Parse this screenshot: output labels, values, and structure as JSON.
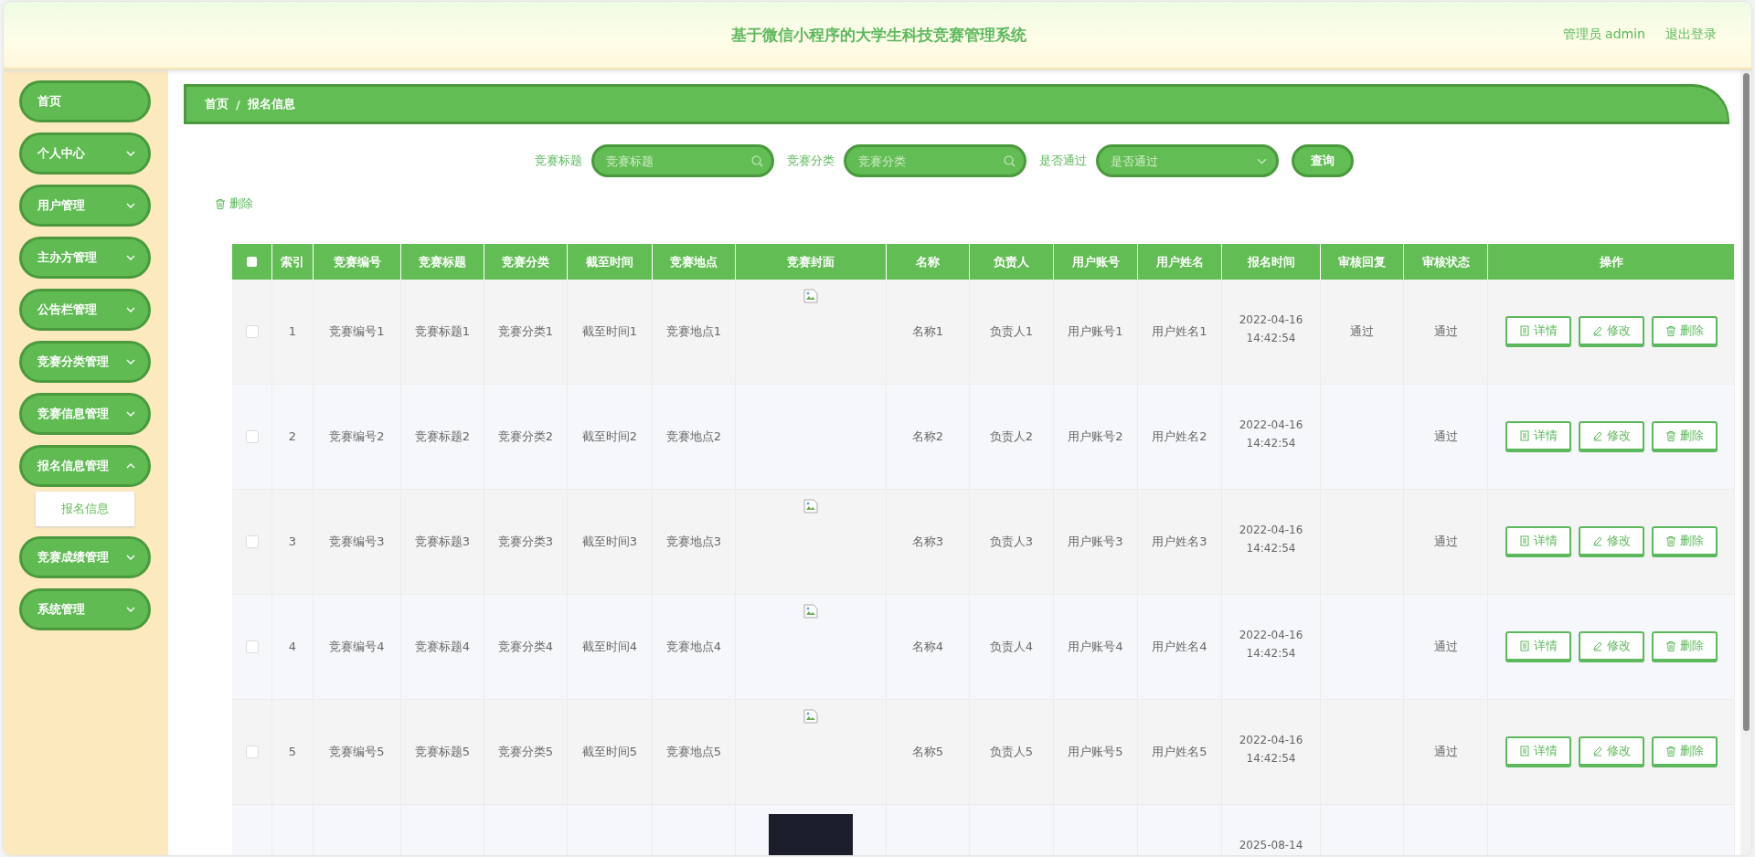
{
  "header": {
    "title": "基于微信小程序的大学生科技竞赛管理系统",
    "user": "管理员 admin",
    "logout": "退出登录"
  },
  "sidebar": {
    "items": [
      {
        "label": "首页"
      },
      {
        "label": "个人中心",
        "expanded": false
      },
      {
        "label": "用户管理",
        "expanded": false
      },
      {
        "label": "主办方管理",
        "expanded": false
      },
      {
        "label": "公告栏管理",
        "expanded": false
      },
      {
        "label": "竞赛分类管理",
        "expanded": false
      },
      {
        "label": "竞赛信息管理",
        "expanded": false
      },
      {
        "label": "报名信息管理",
        "expanded": true,
        "children": [
          {
            "label": "报名信息",
            "selected": true
          }
        ]
      },
      {
        "label": "竞赛成绩管理",
        "expanded": false
      },
      {
        "label": "系统管理",
        "expanded": false
      }
    ]
  },
  "breadcrumb": {
    "items": [
      "首页",
      "报名信息"
    ],
    "separator": "/"
  },
  "search": {
    "fields": [
      {
        "kind": "text",
        "label": "竞赛标题",
        "placeholder": "竞赛标题"
      },
      {
        "kind": "text",
        "label": "竞赛分类",
        "placeholder": "竞赛分类"
      },
      {
        "kind": "select",
        "label": "是否通过",
        "placeholder": "是否通过"
      }
    ],
    "button": "查询"
  },
  "bulk_delete": "删除",
  "table": {
    "select_all_checked": false,
    "columns": [
      "索引",
      "竞赛编号",
      "竞赛标题",
      "竞赛分类",
      "截至时间",
      "竞赛地点",
      "竞赛封面",
      "名称",
      "负责人",
      "用户账号",
      "用户姓名",
      "报名时间",
      "审核回复",
      "审核状态",
      "操作"
    ],
    "rows": [
      {
        "checked": false,
        "cells": [
          "1",
          "竞赛编号1",
          "竞赛标题1",
          "竞赛分类1",
          "截至时间1",
          "竞赛地点1",
          "",
          "名称1",
          "负责人1",
          "用户账号1",
          "用户姓名1",
          "2022-04-16 14:42:54",
          "通过",
          "通过"
        ],
        "cover": {
          "kind": "broken"
        },
        "actions": [
          {
            "kind": "detail",
            "label": "详情"
          },
          {
            "kind": "edit",
            "label": "修改"
          },
          {
            "kind": "delete",
            "label": "删除"
          }
        ]
      },
      {
        "checked": false,
        "cells": [
          "2",
          "竞赛编号2",
          "竞赛标题2",
          "竞赛分类2",
          "截至时间2",
          "竞赛地点2",
          "",
          "名称2",
          "负责人2",
          "用户账号2",
          "用户姓名2",
          "2022-04-16 14:42:54",
          "",
          "通过"
        ],
        "actions": [
          {
            "kind": "detail",
            "label": "详情"
          },
          {
            "kind": "edit",
            "label": "修改"
          },
          {
            "kind": "delete",
            "label": "删除"
          }
        ]
      },
      {
        "checked": false,
        "cells": [
          "3",
          "竞赛编号3",
          "竞赛标题3",
          "竞赛分类3",
          "截至时间3",
          "竞赛地点3",
          "",
          "名称3",
          "负责人3",
          "用户账号3",
          "用户姓名3",
          "2022-04-16 14:42:54",
          "",
          "通过"
        ],
        "cover": {
          "kind": "broken"
        },
        "actions": [
          {
            "kind": "detail",
            "label": "详情"
          },
          {
            "kind": "edit",
            "label": "修改"
          },
          {
            "kind": "delete",
            "label": "删除"
          }
        ]
      },
      {
        "checked": false,
        "cells": [
          "4",
          "竞赛编号4",
          "竞赛标题4",
          "竞赛分类4",
          "截至时间4",
          "竞赛地点4",
          "",
          "名称4",
          "负责人4",
          "用户账号4",
          "用户姓名4",
          "2022-04-16 14:42:54",
          "",
          "通过"
        ],
        "cover": {
          "kind": "broken"
        },
        "actions": [
          {
            "kind": "detail",
            "label": "详情"
          },
          {
            "kind": "edit",
            "label": "修改"
          },
          {
            "kind": "delete",
            "label": "删除"
          }
        ]
      },
      {
        "checked": false,
        "cells": [
          "5",
          "竞赛编号5",
          "竞赛标题5",
          "竞赛分类5",
          "截至时间5",
          "竞赛地点5",
          "",
          "名称5",
          "负责人5",
          "用户账号5",
          "用户姓名5",
          "2022-04-16 14:42:54",
          "",
          "通过"
        ],
        "cover": {
          "kind": "broken"
        },
        "actions": [
          {
            "kind": "detail",
            "label": "详情"
          },
          {
            "kind": "edit",
            "label": "修改"
          },
          {
            "kind": "delete",
            "label": "删除"
          }
        ]
      },
      {
        "cells": [
          "",
          "",
          "",
          "",
          "",
          "",
          "",
          "",
          "",
          "",
          "",
          "2025-08-14",
          "",
          ""
        ],
        "cover": {
          "kind": "photo"
        }
      }
    ]
  }
}
